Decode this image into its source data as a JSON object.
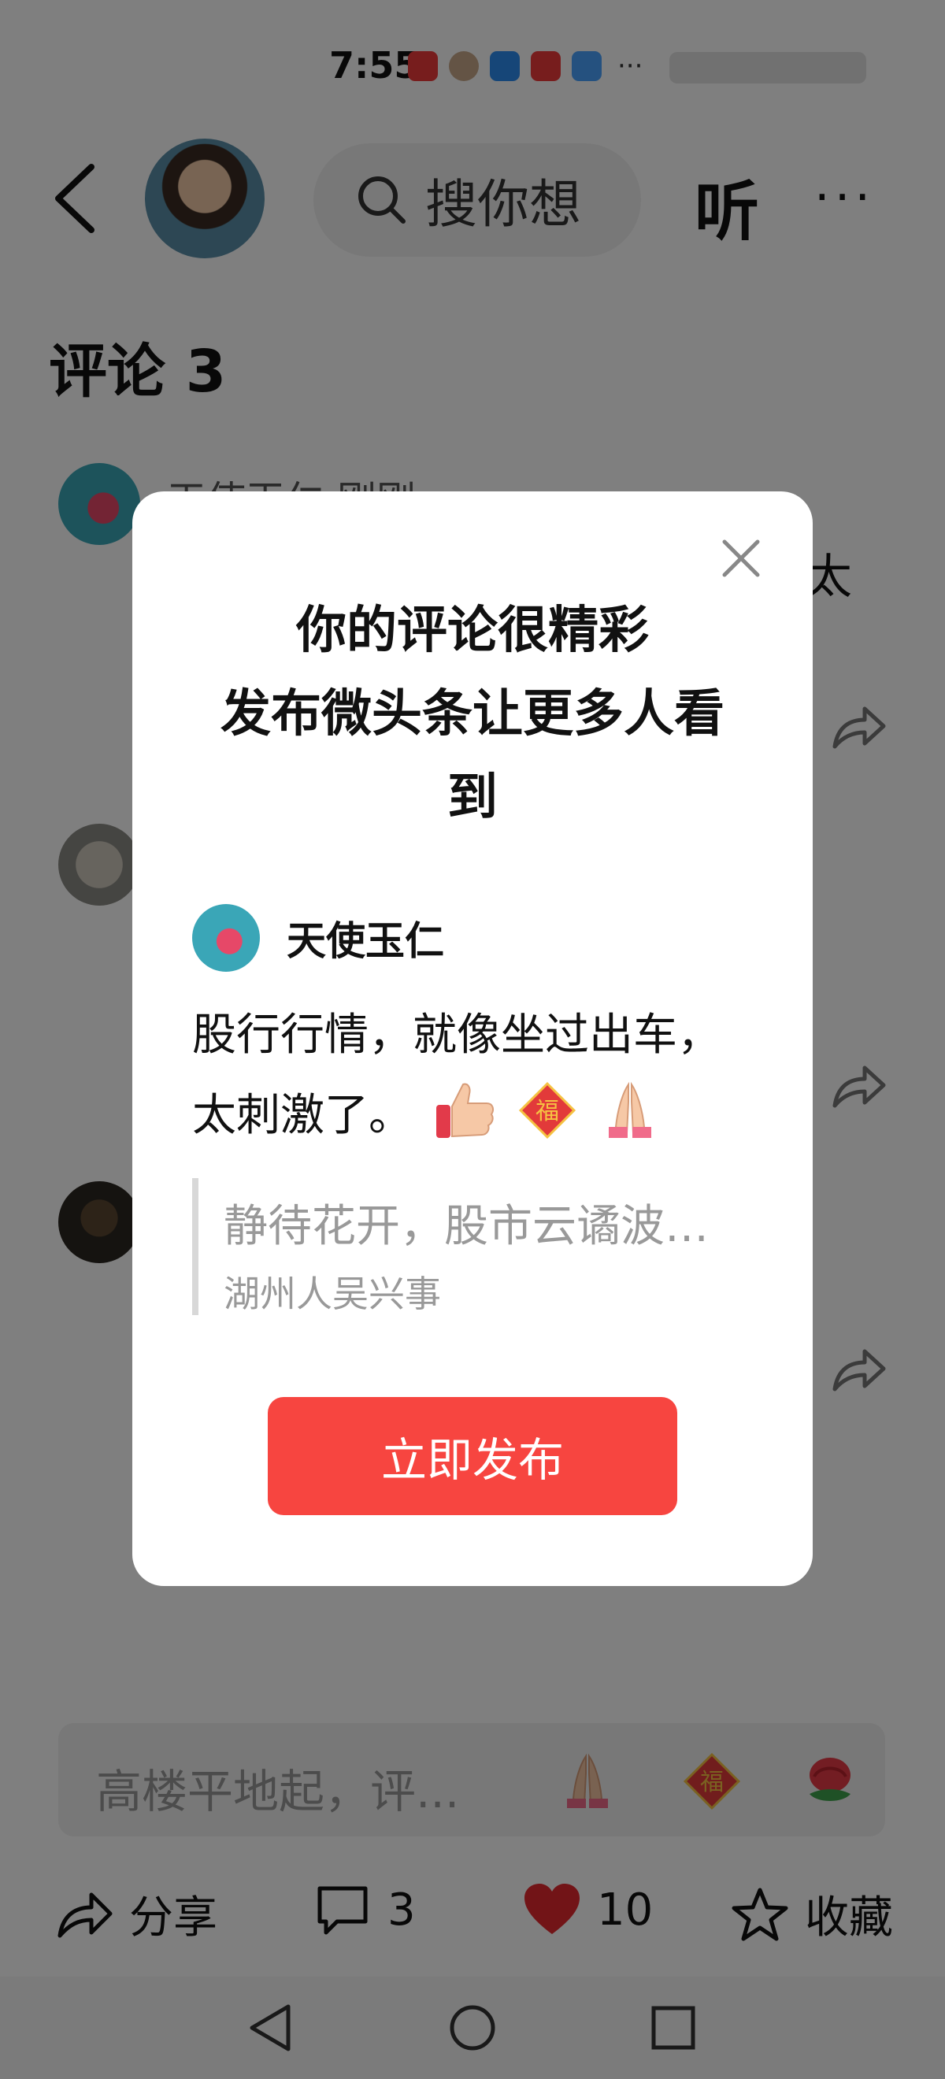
{
  "status_bar": {
    "time": "7:55"
  },
  "header": {
    "search_placeholder": "搜你想",
    "listen_label": "听",
    "more_label": "···"
  },
  "comments": {
    "title": "评论 3",
    "first_name_partial": "天使玉仁  刚刚",
    "first_text_tail": "太"
  },
  "comment_input": {
    "placeholder": "高楼平地起，评..."
  },
  "action_bar": {
    "share_label": "分享",
    "comment_count": "3",
    "like_count": "10",
    "favorite_label": "收藏"
  },
  "modal": {
    "title_line1": "你的评论很精彩",
    "title_line2": "发布微头条让更多人看",
    "title_line3": "到",
    "username": "天使玉仁",
    "comment_text": "股行行情，就像坐过出车，太刺激了。",
    "quote_text": "静待花开，股市云谲波…",
    "quote_author": "湖州人吴兴事",
    "publish_label": "立即发布"
  },
  "colors": {
    "accent": "#f74540",
    "like_red": "#e5282e",
    "overlay": "rgba(0,0,0,0.5)"
  }
}
